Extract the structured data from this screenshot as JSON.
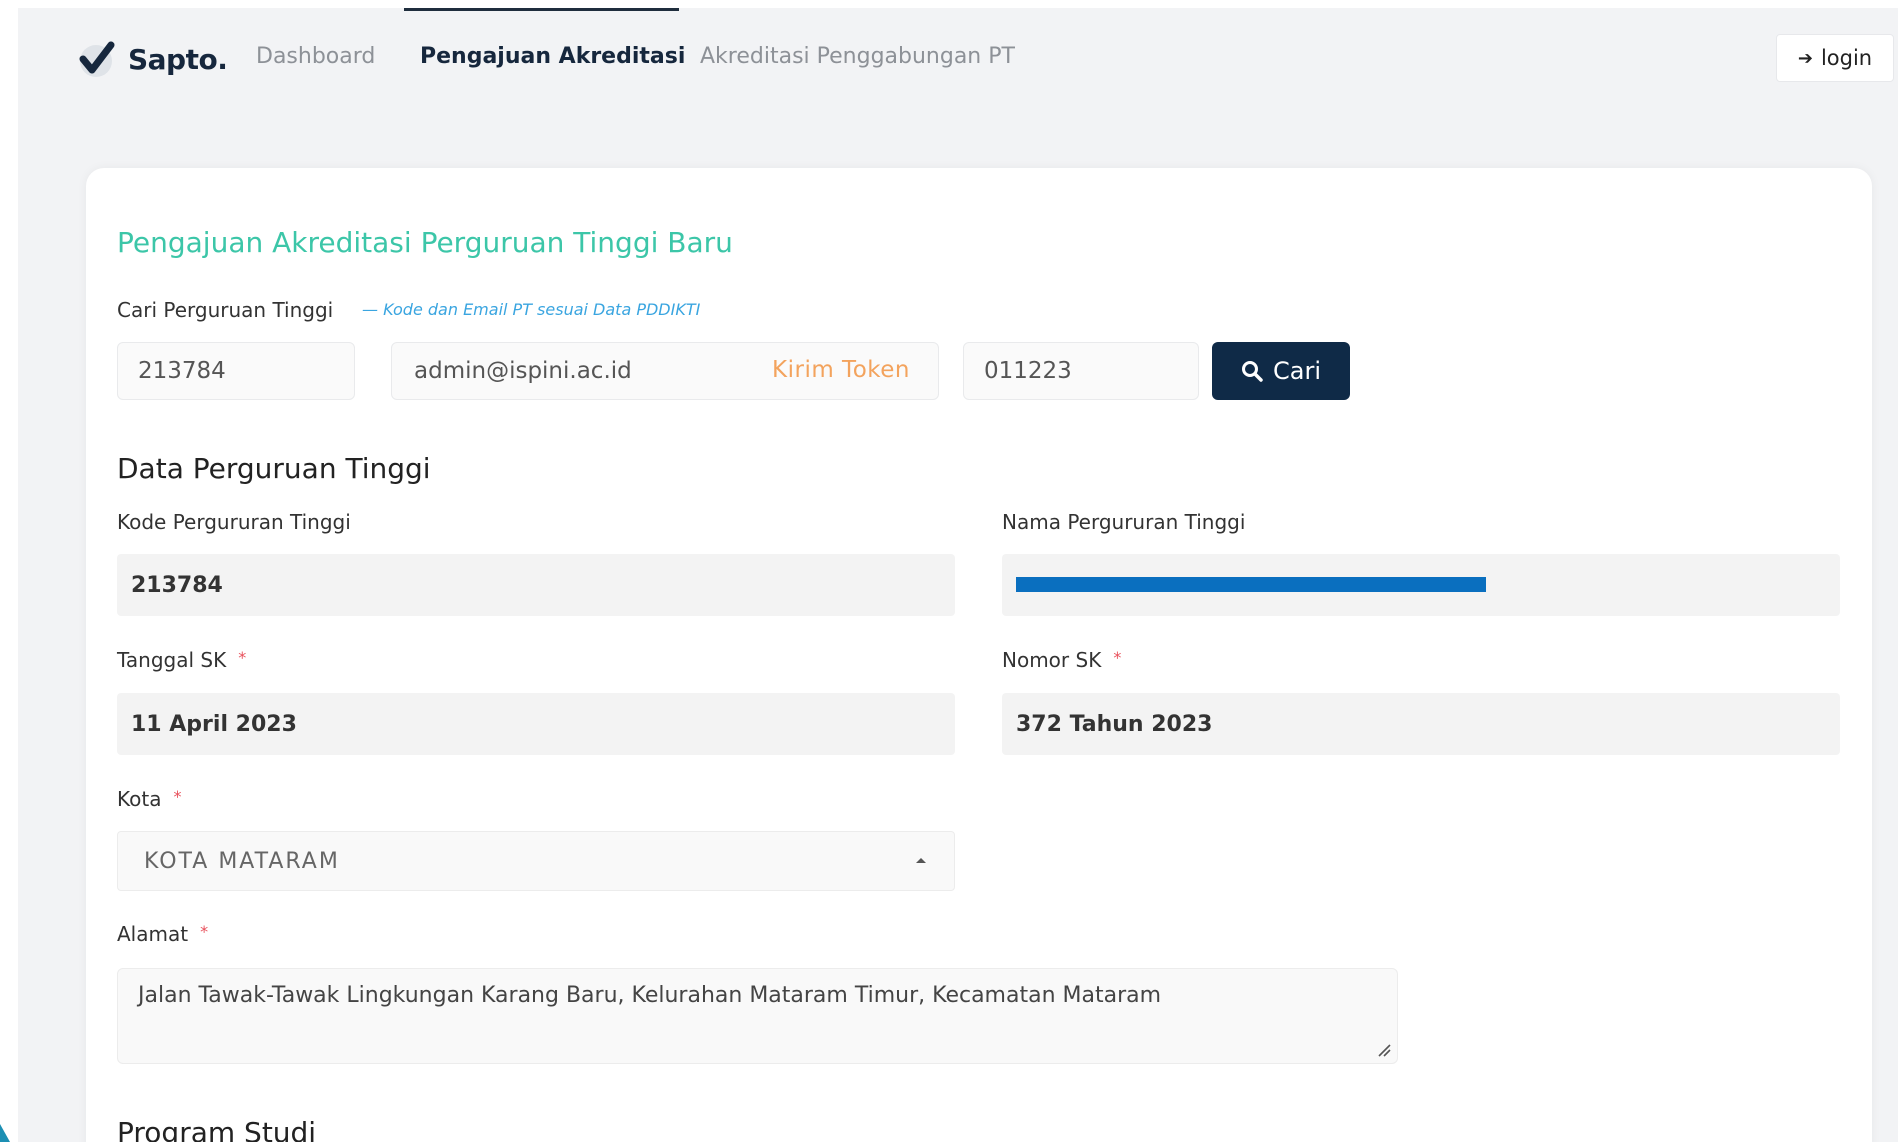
{
  "brand": {
    "name": "Sapto."
  },
  "nav": {
    "items": [
      {
        "label": "Dashboard",
        "active": false
      },
      {
        "label": "Pengajuan Akreditasi",
        "active": true
      },
      {
        "label": "Akreditasi Penggabungan PT",
        "active": false
      }
    ],
    "login_label": "login"
  },
  "colors": {
    "accent_teal": "#3cc6a8",
    "primary_dark": "#0f2a47",
    "token_orange": "#f3a35d",
    "hint_blue": "#3aa5e0",
    "required_red": "#e8505b",
    "redaction_blue": "#0a6fbf"
  },
  "form": {
    "title": "Pengajuan Akreditasi Perguruan Tinggi Baru",
    "search": {
      "label": "Cari Perguruan Tinggi",
      "hint": "— Kode dan Email PT sesuai Data PDDIKTI",
      "kode_value": "213784",
      "email_value": "admin@ispini.ac.id",
      "kirim_token_label": "Kirim Token",
      "token_value": "011223",
      "cari_label": "Cari"
    },
    "data_section": {
      "title": "Data Perguruan Tinggi",
      "kode_label": "Kode Pergururan Tinggi",
      "kode_value": "213784",
      "nama_label": "Nama Pergururan Tinggi",
      "tanggal_sk_label": "Tanggal SK",
      "tanggal_sk_value": "11 April 2023",
      "nomor_sk_label": "Nomor SK",
      "nomor_sk_value": "372 Tahun 2023",
      "kota_label": "Kota",
      "kota_value": "KOTA MATARAM",
      "alamat_label": "Alamat",
      "alamat_value": "Jalan Tawak-Tawak Lingkungan Karang Baru, Kelurahan Mataram Timur, Kecamatan Mataram",
      "required_mark": "*"
    },
    "program_studi_title": "Program Studi"
  }
}
